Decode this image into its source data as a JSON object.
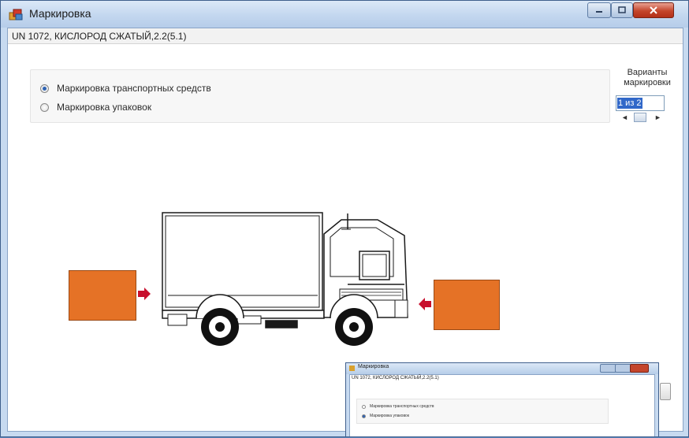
{
  "window": {
    "title": "Маркировка",
    "subject": "UN 1072, КИСЛОРОД СЖАТЫЙ,2.2(5.1)"
  },
  "marking_type": {
    "options": [
      {
        "label": "Маркировка транспортных средств",
        "selected": true
      },
      {
        "label": "Маркировка упаковок",
        "selected": false
      }
    ]
  },
  "variants": {
    "label_line1": "Варианты",
    "label_line2": "маркировки",
    "counter": "1 из 2"
  },
  "illustration": {
    "subject": "truck-with-orange-plates",
    "plate_color": "#e57226",
    "arrow_color": "#c8102e"
  },
  "thumbnail": {
    "title": "Маркировка",
    "subject": "UN 1072, КИСЛОРОД СЖАТЫЙ,2.2(5.1)",
    "options": [
      {
        "label": "Маркировка транспортных средств",
        "selected": false
      },
      {
        "label": "Маркировка упаковок",
        "selected": true
      }
    ]
  },
  "colors": {
    "titlebar": "#c3d7ef",
    "accent": "#3168c9",
    "close_button": "#c4452b"
  }
}
